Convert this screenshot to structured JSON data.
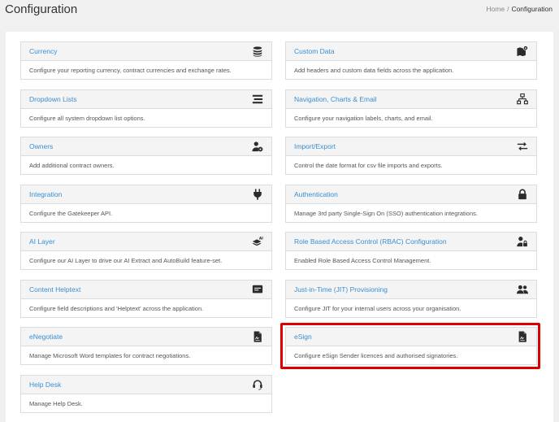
{
  "header": {
    "title": "Configuration",
    "breadcrumb": {
      "home": "Home",
      "separator": "/",
      "current": "Configuration"
    }
  },
  "cards": [
    {
      "title": "Currency",
      "description": "Configure your reporting currency, contract currencies and exchange rates.",
      "icon": "coins-icon"
    },
    {
      "title": "Custom Data",
      "description": "Add headers and custom data fields across the application.",
      "icon": "map-marker-icon"
    },
    {
      "title": "Dropdown Lists",
      "description": "Configure all system dropdown list options.",
      "icon": "list-icon"
    },
    {
      "title": "Navigation, Charts & Email",
      "description": "Configure your navigation labels, charts, and email.",
      "icon": "sitemap-icon"
    },
    {
      "title": "Owners",
      "description": "Add additional contract owners.",
      "icon": "user-cog-icon"
    },
    {
      "title": "Import/Export",
      "description": "Control the date format for csv file imports and exports.",
      "icon": "exchange-icon"
    },
    {
      "title": "Integration",
      "description": "Configure the Gatekeeper API.",
      "icon": "plug-icon"
    },
    {
      "title": "Authentication",
      "description": "Manage 3rd party Single-Sign On (SSO) authentication integrations.",
      "icon": "lock-icon"
    },
    {
      "title": "AI Layer",
      "description": "Configure our AI Layer to drive our AI Extract and AutoBuild feature-set.",
      "icon": "ai-layers-icon"
    },
    {
      "title": "Role Based Access Control (RBAC) Configuration",
      "description": "Enabled Role Based Access Control Management.",
      "icon": "user-lock-icon"
    },
    {
      "title": "Content Helptext",
      "description": "Configure field descriptions and 'Helptext' across the application.",
      "icon": "comment-icon"
    },
    {
      "title": "Just-in-Time (JIT) Provisioning",
      "description": "Configure JIT for your internal users across your organisation.",
      "icon": "users-icon"
    },
    {
      "title": "eNegotiate",
      "description": "Manage Microsoft Word templates for contract negotiations.",
      "icon": "file-signature-icon"
    },
    {
      "title": "eSign",
      "description": "Configure eSign Sender licences and authorised signatories.",
      "icon": "file-signature-icon"
    },
    {
      "title": "Help Desk",
      "description": "Manage Help Desk.",
      "icon": "headset-icon"
    }
  ]
}
